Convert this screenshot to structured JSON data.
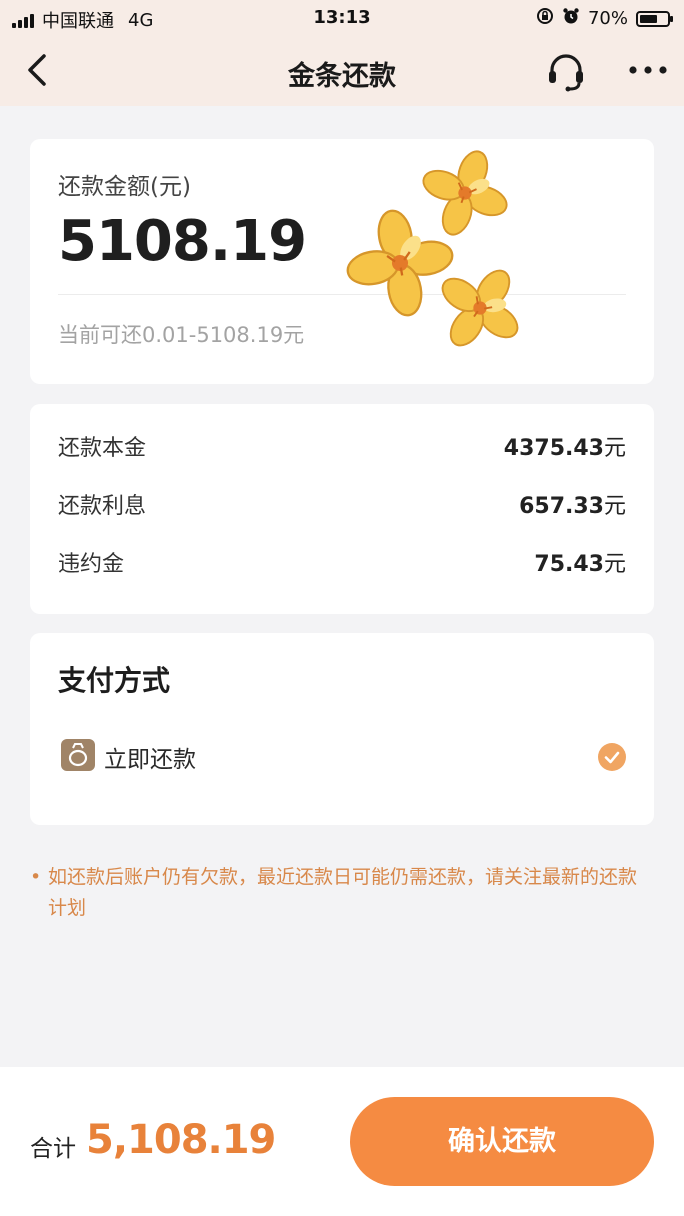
{
  "status_bar": {
    "carrier": "中国联通",
    "network": "4G",
    "time": "13:13",
    "battery": "70%",
    "battery_level": 0.7
  },
  "nav": {
    "title": "金条还款",
    "back_icon": "chevron-left-icon",
    "service_icon": "headset-icon",
    "more_icon": "more-dots-icon"
  },
  "amount_card": {
    "label": "还款金额(元)",
    "value": "5108.19",
    "range_text": "当前可还0.01-5108.19元"
  },
  "breakdown": {
    "rows": [
      {
        "label": "还款本金",
        "value": "4375.43",
        "unit": "元"
      },
      {
        "label": "还款利息",
        "value": "657.33",
        "unit": "元"
      },
      {
        "label": "违约金",
        "value": "75.43",
        "unit": "元"
      }
    ]
  },
  "payment": {
    "title": "支付方式",
    "method": "立即还款",
    "selected": true
  },
  "notice": {
    "bullet": "•",
    "text": "如还款后账户仍有欠款，最近还款日可能仍需还款，请关注最新的还款计划"
  },
  "footer": {
    "total_label": "合计",
    "total_value": "5,108.19",
    "confirm_label": "确认还款"
  },
  "colors": {
    "accent": "#f58b42",
    "amount_orange": "#e8823a",
    "notice_orange": "#d8884a",
    "header_bg": "#f7ece6",
    "page_bg": "#f3f3f5"
  }
}
